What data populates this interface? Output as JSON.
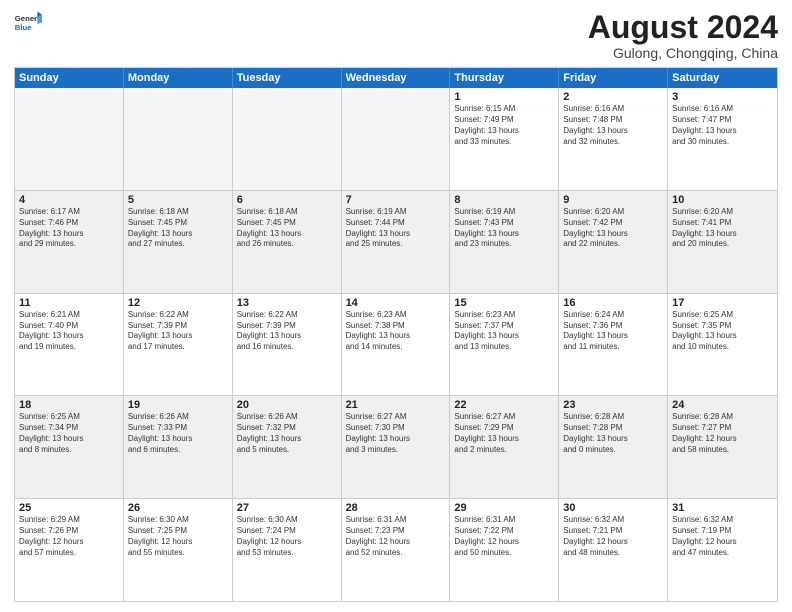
{
  "logo": {
    "line1": "General",
    "line2": "Blue"
  },
  "title": "August 2024",
  "location": "Gulong, Chongqing, China",
  "header_days": [
    "Sunday",
    "Monday",
    "Tuesday",
    "Wednesday",
    "Thursday",
    "Friday",
    "Saturday"
  ],
  "weeks": [
    [
      {
        "day": "",
        "info": "",
        "empty": true
      },
      {
        "day": "",
        "info": "",
        "empty": true
      },
      {
        "day": "",
        "info": "",
        "empty": true
      },
      {
        "day": "",
        "info": "",
        "empty": true
      },
      {
        "day": "1",
        "info": "Sunrise: 6:15 AM\nSunset: 7:49 PM\nDaylight: 13 hours\nand 33 minutes."
      },
      {
        "day": "2",
        "info": "Sunrise: 6:16 AM\nSunset: 7:48 PM\nDaylight: 13 hours\nand 32 minutes."
      },
      {
        "day": "3",
        "info": "Sunrise: 6:16 AM\nSunset: 7:47 PM\nDaylight: 13 hours\nand 30 minutes."
      }
    ],
    [
      {
        "day": "4",
        "info": "Sunrise: 6:17 AM\nSunset: 7:46 PM\nDaylight: 13 hours\nand 29 minutes."
      },
      {
        "day": "5",
        "info": "Sunrise: 6:18 AM\nSunset: 7:45 PM\nDaylight: 13 hours\nand 27 minutes."
      },
      {
        "day": "6",
        "info": "Sunrise: 6:18 AM\nSunset: 7:45 PM\nDaylight: 13 hours\nand 26 minutes."
      },
      {
        "day": "7",
        "info": "Sunrise: 6:19 AM\nSunset: 7:44 PM\nDaylight: 13 hours\nand 25 minutes."
      },
      {
        "day": "8",
        "info": "Sunrise: 6:19 AM\nSunset: 7:43 PM\nDaylight: 13 hours\nand 23 minutes."
      },
      {
        "day": "9",
        "info": "Sunrise: 6:20 AM\nSunset: 7:42 PM\nDaylight: 13 hours\nand 22 minutes."
      },
      {
        "day": "10",
        "info": "Sunrise: 6:20 AM\nSunset: 7:41 PM\nDaylight: 13 hours\nand 20 minutes."
      }
    ],
    [
      {
        "day": "11",
        "info": "Sunrise: 6:21 AM\nSunset: 7:40 PM\nDaylight: 13 hours\nand 19 minutes."
      },
      {
        "day": "12",
        "info": "Sunrise: 6:22 AM\nSunset: 7:39 PM\nDaylight: 13 hours\nand 17 minutes."
      },
      {
        "day": "13",
        "info": "Sunrise: 6:22 AM\nSunset: 7:39 PM\nDaylight: 13 hours\nand 16 minutes."
      },
      {
        "day": "14",
        "info": "Sunrise: 6:23 AM\nSunset: 7:38 PM\nDaylight: 13 hours\nand 14 minutes."
      },
      {
        "day": "15",
        "info": "Sunrise: 6:23 AM\nSunset: 7:37 PM\nDaylight: 13 hours\nand 13 minutes."
      },
      {
        "day": "16",
        "info": "Sunrise: 6:24 AM\nSunset: 7:36 PM\nDaylight: 13 hours\nand 11 minutes."
      },
      {
        "day": "17",
        "info": "Sunrise: 6:25 AM\nSunset: 7:35 PM\nDaylight: 13 hours\nand 10 minutes."
      }
    ],
    [
      {
        "day": "18",
        "info": "Sunrise: 6:25 AM\nSunset: 7:34 PM\nDaylight: 13 hours\nand 8 minutes."
      },
      {
        "day": "19",
        "info": "Sunrise: 6:26 AM\nSunset: 7:33 PM\nDaylight: 13 hours\nand 6 minutes."
      },
      {
        "day": "20",
        "info": "Sunrise: 6:26 AM\nSunset: 7:32 PM\nDaylight: 13 hours\nand 5 minutes."
      },
      {
        "day": "21",
        "info": "Sunrise: 6:27 AM\nSunset: 7:30 PM\nDaylight: 13 hours\nand 3 minutes."
      },
      {
        "day": "22",
        "info": "Sunrise: 6:27 AM\nSunset: 7:29 PM\nDaylight: 13 hours\nand 2 minutes."
      },
      {
        "day": "23",
        "info": "Sunrise: 6:28 AM\nSunset: 7:28 PM\nDaylight: 13 hours\nand 0 minutes."
      },
      {
        "day": "24",
        "info": "Sunrise: 6:28 AM\nSunset: 7:27 PM\nDaylight: 12 hours\nand 58 minutes."
      }
    ],
    [
      {
        "day": "25",
        "info": "Sunrise: 6:29 AM\nSunset: 7:26 PM\nDaylight: 12 hours\nand 57 minutes."
      },
      {
        "day": "26",
        "info": "Sunrise: 6:30 AM\nSunset: 7:25 PM\nDaylight: 12 hours\nand 55 minutes."
      },
      {
        "day": "27",
        "info": "Sunrise: 6:30 AM\nSunset: 7:24 PM\nDaylight: 12 hours\nand 53 minutes."
      },
      {
        "day": "28",
        "info": "Sunrise: 6:31 AM\nSunset: 7:23 PM\nDaylight: 12 hours\nand 52 minutes."
      },
      {
        "day": "29",
        "info": "Sunrise: 6:31 AM\nSunset: 7:22 PM\nDaylight: 12 hours\nand 50 minutes."
      },
      {
        "day": "30",
        "info": "Sunrise: 6:32 AM\nSunset: 7:21 PM\nDaylight: 12 hours\nand 48 minutes."
      },
      {
        "day": "31",
        "info": "Sunrise: 6:32 AM\nSunset: 7:19 PM\nDaylight: 12 hours\nand 47 minutes."
      }
    ]
  ]
}
